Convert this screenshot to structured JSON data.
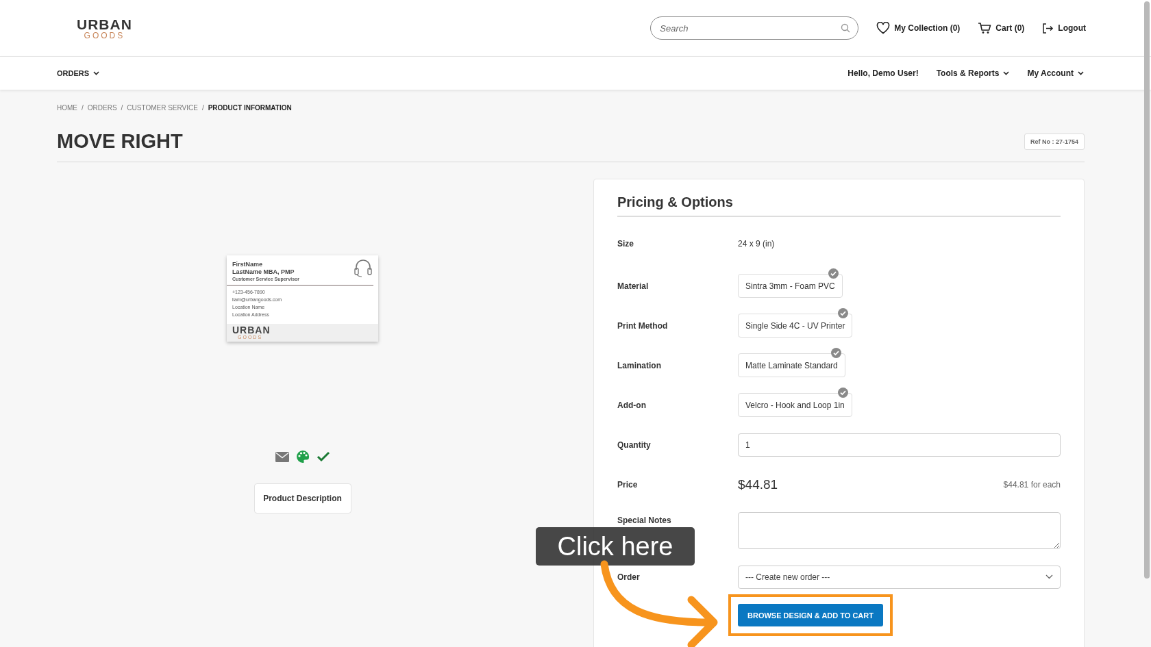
{
  "header": {
    "logo": {
      "line_1": "URBAN",
      "line_2": "GOODS"
    },
    "search": {
      "placeholder": "Search"
    },
    "links": [
      {
        "kind": "collection",
        "label": "My Collection (0)"
      },
      {
        "kind": "cart",
        "label": "Cart (0)"
      },
      {
        "kind": "logout",
        "label": "Logout"
      }
    ]
  },
  "nav": {
    "left": [
      {
        "label": "ORDERS",
        "dropdown": true
      }
    ],
    "right": [
      {
        "label": "Hello, Demo User!",
        "dropdown": false
      },
      {
        "label": "Tools & Reports",
        "dropdown": true
      },
      {
        "label": "My Account",
        "dropdown": true
      }
    ]
  },
  "breadcrumb": [
    {
      "label": "HOME",
      "current": false
    },
    {
      "separator": "/",
      "label": "ORDERS",
      "current": false
    },
    {
      "separator": "/",
      "label": "CUSTOMER SERVICE",
      "current": false
    },
    {
      "separator": "/",
      "label": "PRODUCT INFORMATION",
      "current": true
    }
  ],
  "title": "MOVE RIGHT",
  "ref_no": "Ref No : 27-1754",
  "product": {
    "card": {
      "first_name": "FirstName",
      "last_name": "LastName MBA, PMP",
      "role": "Customer Service Supervisor",
      "lines": [
        "+123-456-7890",
        "liam@urbangoods.com",
        "Location Name",
        "Location Address"
      ],
      "logo_1": "URBAN",
      "logo_2": "GOODS"
    },
    "description_button": "Product Description"
  },
  "panel": {
    "title": "Pricing & Options",
    "rows": [
      {
        "kind": "text",
        "label": "Size",
        "value": "24 x 9 (in)"
      },
      {
        "kind": "choice",
        "label": "Material",
        "value": "Sintra 3mm - Foam PVC",
        "checked": true
      },
      {
        "kind": "choice",
        "label": "Print Method",
        "value": "Single Side 4C - UV Printer",
        "checked": true
      },
      {
        "kind": "choice",
        "label": "Lamination",
        "value": "Matte Laminate Standard",
        "checked": true
      },
      {
        "kind": "choice",
        "label": "Add-on",
        "value": "Velcro - Hook and Loop 1in",
        "checked": true
      },
      {
        "kind": "input",
        "label": "Quantity",
        "value": "1"
      },
      {
        "kind": "price",
        "label": "Price",
        "value": "$44.81",
        "each": "$44.81 for each"
      },
      {
        "kind": "textarea",
        "label": "Special Notes"
      },
      {
        "kind": "select",
        "label": "Order",
        "value": "--- Create new order ---"
      }
    ],
    "button": "BROWSE DESIGN & ADD TO CART"
  },
  "callout": "Click here"
}
